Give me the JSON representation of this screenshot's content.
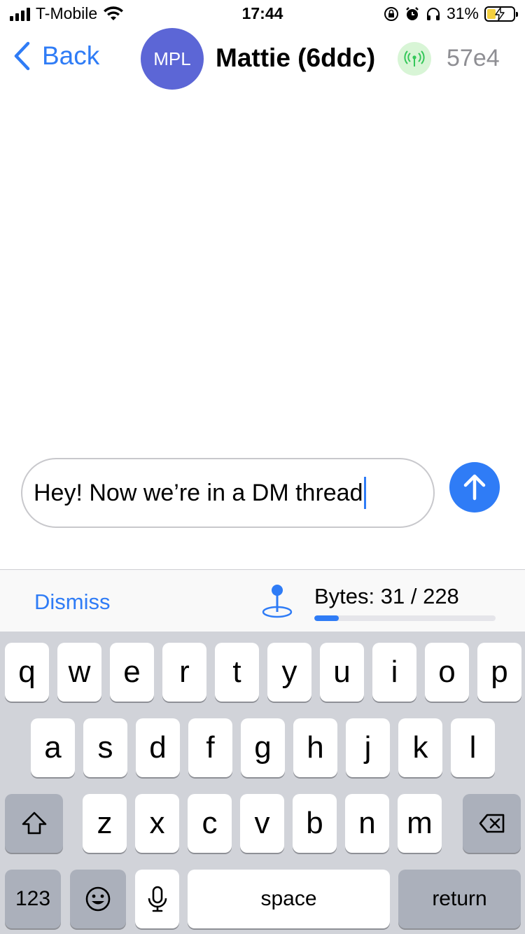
{
  "status_bar": {
    "carrier": "T-Mobile",
    "time": "17:44",
    "battery_percent": "31%",
    "battery_level": 0.31,
    "icons": [
      "signal-icon",
      "wifi-icon",
      "orientation-lock-icon",
      "alarm-icon",
      "headphones-icon",
      "battery-charging-icon"
    ]
  },
  "header": {
    "back_label": "Back",
    "avatar_initials": "MPL",
    "contact_name": "Mattie (6ddc)",
    "node_id": "57e4",
    "mesh_icon": "antenna-icon",
    "avatar_color": "#5c66d6"
  },
  "composer": {
    "text": "Hey! Now we’re in a DM thread",
    "send_icon": "arrow-up-icon"
  },
  "accessory": {
    "dismiss_label": "Dismiss",
    "location_icon": "location-pin-icon",
    "bytes_label": "Bytes: 31 / 228",
    "bytes_used": 31,
    "bytes_max": 228
  },
  "keyboard": {
    "row1": [
      "q",
      "w",
      "e",
      "r",
      "t",
      "y",
      "u",
      "i",
      "o",
      "p"
    ],
    "row2": [
      "a",
      "s",
      "d",
      "f",
      "g",
      "h",
      "j",
      "k",
      "l"
    ],
    "row3": [
      "z",
      "x",
      "c",
      "v",
      "b",
      "n",
      "m"
    ],
    "numbers_label": "123",
    "space_label": "space",
    "return_label": "return",
    "shift_icon": "shift-icon",
    "backspace_icon": "backspace-icon",
    "emoji_icon": "emoji-icon",
    "mic_icon": "microphone-icon"
  },
  "colors": {
    "accent": "#2f7cf6",
    "mesh_badge_bg": "#d8f5d6",
    "keyboard_bg": "#d1d3d9"
  }
}
